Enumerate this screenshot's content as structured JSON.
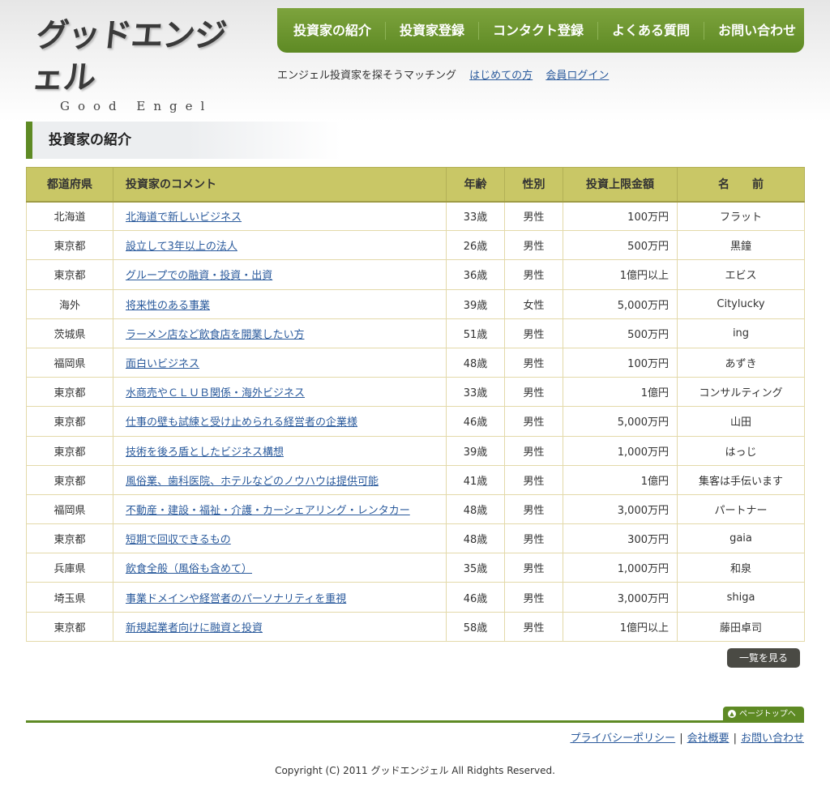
{
  "logo": {
    "main": "グッドエンジェル",
    "sub": "Good Engel"
  },
  "nav": {
    "items": [
      {
        "label": "投資家の紹介"
      },
      {
        "label": "投資家登録"
      },
      {
        "label": "コンタクト登録"
      },
      {
        "label": "よくある質問"
      },
      {
        "label": "お問い合わせ"
      }
    ]
  },
  "tagline": {
    "text": "エンジェル投資家を探そうマッチング",
    "link_beginners": "はじめての方",
    "link_login": "会員ログイン"
  },
  "section": {
    "title": "投資家の紹介"
  },
  "table": {
    "headers": {
      "prefecture": "都道府県",
      "comment": "投資家のコメント",
      "age": "年齢",
      "gender": "性別",
      "amount": "投資上限金額",
      "name": "名　　前"
    },
    "rows": [
      {
        "prefecture": "北海道",
        "comment": "北海道で新しいビジネス",
        "age": "33歳",
        "gender": "男性",
        "amount": "100万円",
        "name": "フラット"
      },
      {
        "prefecture": "東京都",
        "comment": "設立して3年以上の法人",
        "age": "26歳",
        "gender": "男性",
        "amount": "500万円",
        "name": "黒鐘"
      },
      {
        "prefecture": "東京都",
        "comment": "グループでの融資・投資・出資",
        "age": "36歳",
        "gender": "男性",
        "amount": "1億円以上",
        "name": "エビス"
      },
      {
        "prefecture": "海外",
        "comment": "将来性のある事業",
        "age": "39歳",
        "gender": "女性",
        "amount": "5,000万円",
        "name": "Citylucky"
      },
      {
        "prefecture": "茨城県",
        "comment": "ラーメン店など飲食店を開業したい方",
        "age": "51歳",
        "gender": "男性",
        "amount": "500万円",
        "name": "ing"
      },
      {
        "prefecture": "福岡県",
        "comment": "面白いビジネス",
        "age": "48歳",
        "gender": "男性",
        "amount": "100万円",
        "name": "あずき"
      },
      {
        "prefecture": "東京都",
        "comment": "水商売やＣＬＵＢ関係・海外ビジネス",
        "age": "33歳",
        "gender": "男性",
        "amount": "1億円",
        "name": "コンサルティング"
      },
      {
        "prefecture": "東京都",
        "comment": "仕事の壁も試練と受け止められる経営者の企業様",
        "age": "46歳",
        "gender": "男性",
        "amount": "5,000万円",
        "name": "山田"
      },
      {
        "prefecture": "東京都",
        "comment": "技術を後ろ盾としたビジネス構想",
        "age": "39歳",
        "gender": "男性",
        "amount": "1,000万円",
        "name": "はっじ"
      },
      {
        "prefecture": "東京都",
        "comment": "風俗業、歯科医院、ホテルなどのノウハウは提供可能",
        "age": "41歳",
        "gender": "男性",
        "amount": "1億円",
        "name": "集客は手伝います"
      },
      {
        "prefecture": "福岡県",
        "comment": "不動産・建設・福祉・介護・カーシェアリング・レンタカー",
        "age": "48歳",
        "gender": "男性",
        "amount": "3,000万円",
        "name": "パートナー"
      },
      {
        "prefecture": "東京都",
        "comment": "短期で回収できるもの",
        "age": "48歳",
        "gender": "男性",
        "amount": "300万円",
        "name": "gaia"
      },
      {
        "prefecture": "兵庫県",
        "comment": "飲食全般（風俗も含めて）",
        "age": "35歳",
        "gender": "男性",
        "amount": "1,000万円",
        "name": "和泉"
      },
      {
        "prefecture": "埼玉県",
        "comment": "事業ドメインや経営者のパーソナリティを重視",
        "age": "46歳",
        "gender": "男性",
        "amount": "3,000万円",
        "name": "shiga"
      },
      {
        "prefecture": "東京都",
        "comment": "新規起業者向けに融資と投資",
        "age": "58歳",
        "gender": "男性",
        "amount": "1億円以上",
        "name": "藤田卓司"
      }
    ]
  },
  "buttons": {
    "view_list": "一覧を見る",
    "page_top": "ページトップへ"
  },
  "footer": {
    "privacy": "プライバシーポリシー",
    "company": "会社概要",
    "contact": "お問い合わせ",
    "separator": "|",
    "copyright": "Copyright (C) 2011 グッドエンジェル All Ridghts Reserved."
  },
  "colors": {
    "brand_green": "#5e8a24",
    "table_header": "#c9c766",
    "link": "#2a5a9c"
  }
}
